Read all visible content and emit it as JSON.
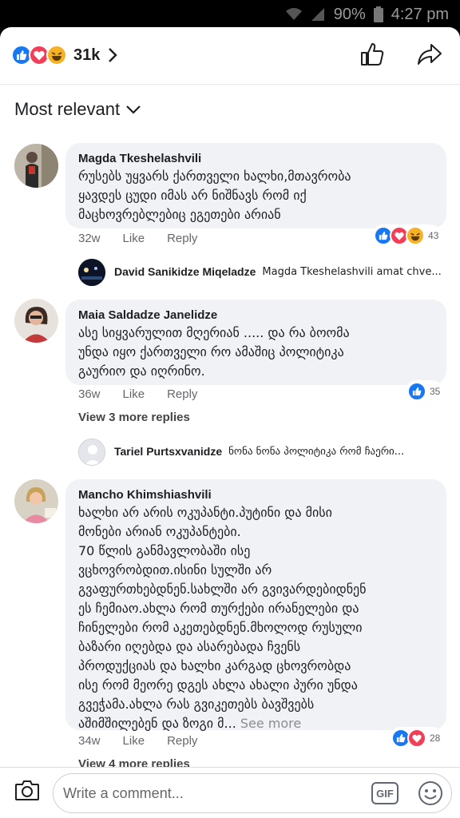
{
  "status": {
    "battery": "90%",
    "time": "4:27 pm"
  },
  "header": {
    "reaction_count": "31k"
  },
  "sort": {
    "label": "Most relevant"
  },
  "comments": [
    {
      "name": "Magda Tkeshelashvili",
      "text": "რუსებს უყვარს ქართველი ხალხი,მთავრობა\nყავდეს ცუდი იმას არ ნიშნავს რომ იქ\nმაცხოვრებლებიც ეგეთები არიან",
      "time": "32w",
      "like": "Like",
      "reply": "Reply",
      "reactions": "43",
      "reply_preview": {
        "name": "David Sanikidze Miqeladze",
        "text": "Magda Tkeshelashvili amat chve..."
      }
    },
    {
      "name": "Maia Saldadze Janelidze",
      "text": "ასე სიყვარულით მღერიან ..... და რა ბოომა\nუნდა იყო ქართველი რო ამაშიც პოლიტიკა\nგაურიო და  იღრინო.",
      "time": "36w",
      "like": "Like",
      "reply": "Reply",
      "reactions": "35",
      "view_more": "View 3 more replies",
      "reply_preview": {
        "name": "Tariel Purtsxvanidze",
        "text": "ნონა ნონა პოლიტიკა რომ ჩაერი..."
      }
    },
    {
      "name": "Mancho Khimshiashvili",
      "text": "ხალხი არ არის ოკუპანტი.პუტინი და მისი\nმონები არიან ოკუპანტები.\n70 წლის განმავლობაში ისე\nვცხოვრობდით.ისინი სულში არ\nგვაფურთხებდნენ.სახლში არ გვივარდებიდნენ\nეს ჩემიაო.ახლა რომ თურქები ირანელები და\nჩინელები რომ აკეთებდნენ.მხოლოდ რუსული\nბაზარი იღებდა და ასარებადა ჩვენს\nპროდუქციას და ხალხი კარგად ცხოვრობდა\nისე რომ მეორე დგეს ახლა ახალი პური უნდა\nგვეჭამა.ახლა რას გვიკეთებს ბავშვებს\nაშიმშილებენ და ზოგი მ...",
      "see_more": "See more",
      "time": "34w",
      "like": "Like",
      "reply": "Reply",
      "reactions": "28",
      "view_more": "View 4 more replies"
    }
  ],
  "composer": {
    "placeholder": "Write a comment...",
    "gif": "GIF"
  },
  "colors": {
    "like": "#1877f2",
    "love": "#f33e58",
    "haha": "#f7b125"
  }
}
